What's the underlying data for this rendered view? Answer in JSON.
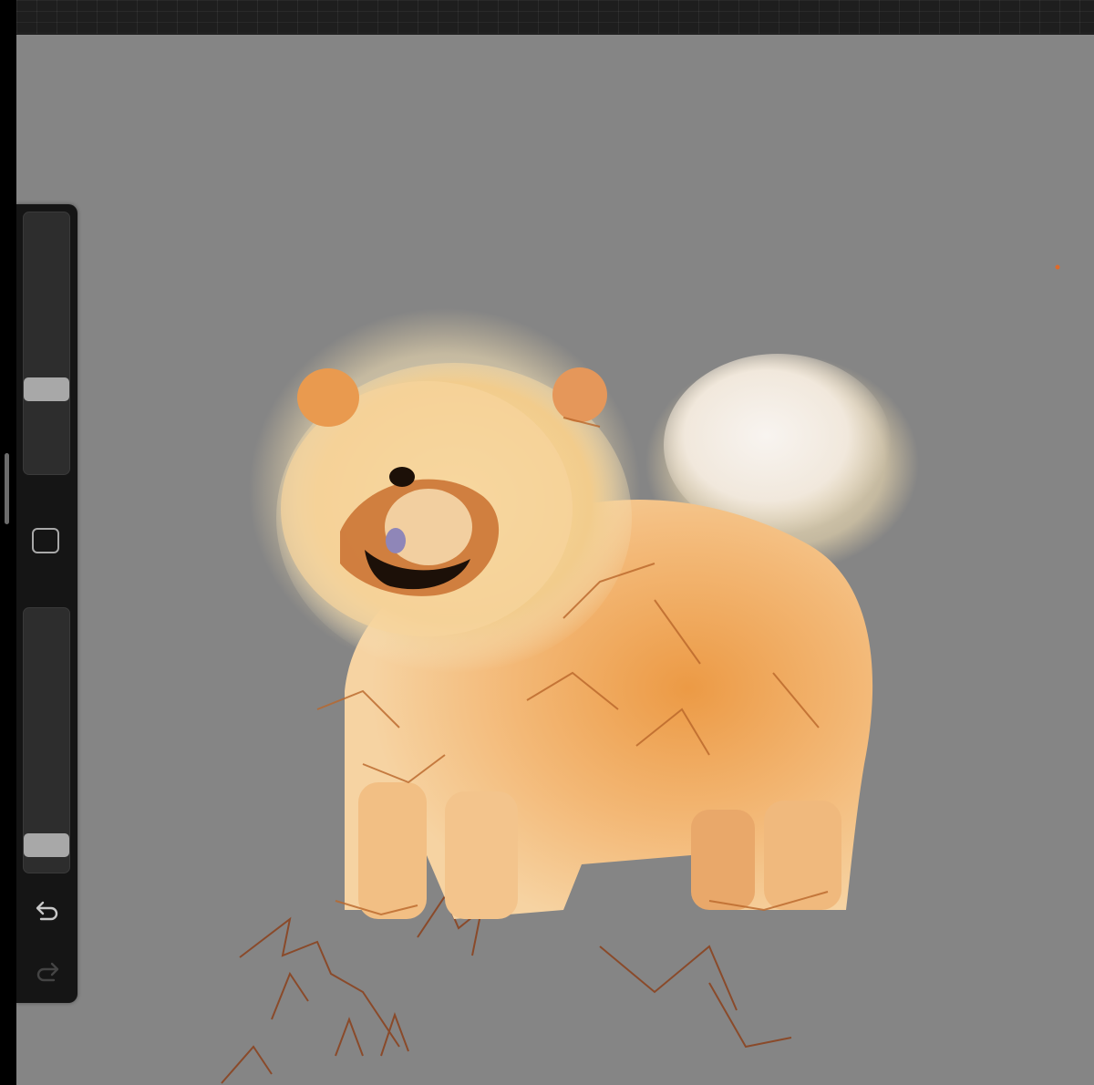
{
  "app": {
    "name": "",
    "accent_color": "#858585"
  },
  "sidebar": {
    "brush_size_level": 0.3,
    "brush_opacity_level": 0.05,
    "modify_icon": "square-outline-icon",
    "undo_icon": "undo-arrow-icon",
    "redo_icon": "redo-arrow-icon",
    "undo_enabled": true,
    "redo_enabled": false
  },
  "canvas": {
    "background_color": "#858585",
    "subject": "chow-chow-dog-painting",
    "sketch_layer": "brown-line-sketch"
  }
}
